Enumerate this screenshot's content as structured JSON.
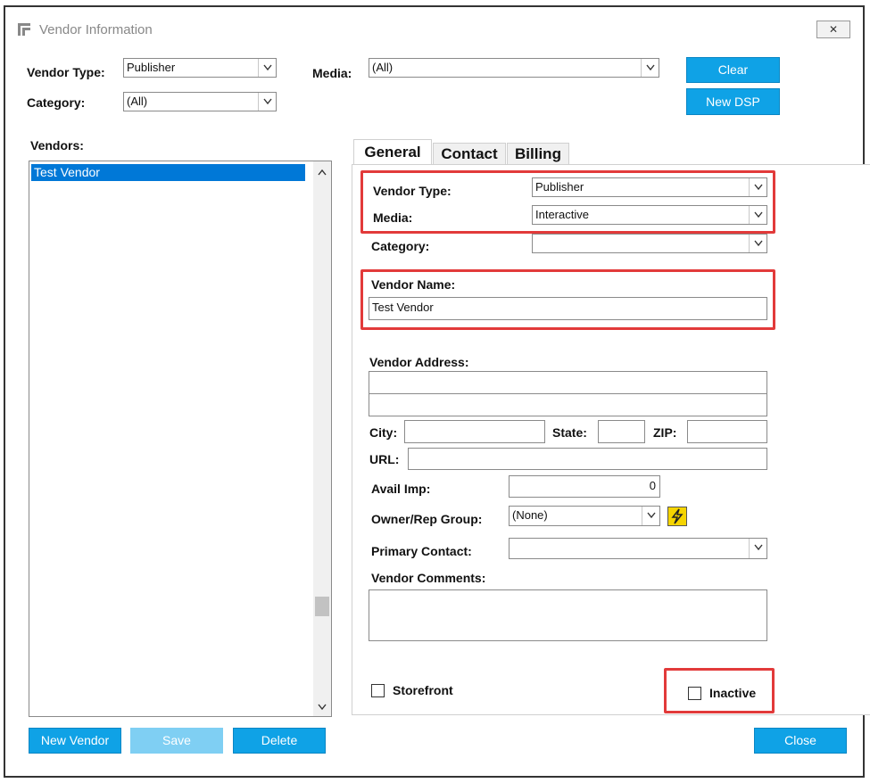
{
  "window": {
    "title": "Vendor Information",
    "close_glyph": "✕"
  },
  "filters": {
    "vendor_type_label": "Vendor Type:",
    "vendor_type_value": "Publisher",
    "category_label": "Category:",
    "category_value": "(All)",
    "media_label": "Media:",
    "media_value": "(All)",
    "clear_button": "Clear",
    "new_dsp_button": "New DSP"
  },
  "vendors": {
    "label": "Vendors:",
    "items": [
      "Test Vendor"
    ]
  },
  "tabs": [
    {
      "label": "General",
      "active": true
    },
    {
      "label": "Contact",
      "active": false
    },
    {
      "label": "Billing",
      "active": false
    }
  ],
  "general": {
    "vendor_type_label": "Vendor Type:",
    "vendor_type_value": "Publisher",
    "media_label": "Media:",
    "media_value": "Interactive",
    "category_label": "Category:",
    "category_value": "",
    "vendor_name_label": "Vendor Name:",
    "vendor_name_value": "Test Vendor",
    "vendor_address_label": "Vendor Address:",
    "address_line1": "",
    "address_line2": "",
    "city_label": "City:",
    "city_value": "",
    "state_label": "State:",
    "state_value": "",
    "zip_label": "ZIP:",
    "zip_value": "",
    "url_label": "URL:",
    "url_value": "",
    "avail_imp_label": "Avail Imp:",
    "avail_imp_value": "0",
    "owner_rep_label": "Owner/Rep Group:",
    "owner_rep_value": "(None)",
    "primary_contact_label": "Primary Contact:",
    "primary_contact_value": "",
    "vendor_comments_label": "Vendor Comments:",
    "vendor_comments_value": "",
    "storefront_label": "Storefront",
    "inactive_label": "Inactive"
  },
  "footer": {
    "new_vendor_button": "New Vendor",
    "save_button": "Save",
    "delete_button": "Delete",
    "close_button": "Close"
  },
  "colors": {
    "accent": "#0fa2e6",
    "selection": "#0078d7",
    "highlight_box": "#e23a3a"
  }
}
